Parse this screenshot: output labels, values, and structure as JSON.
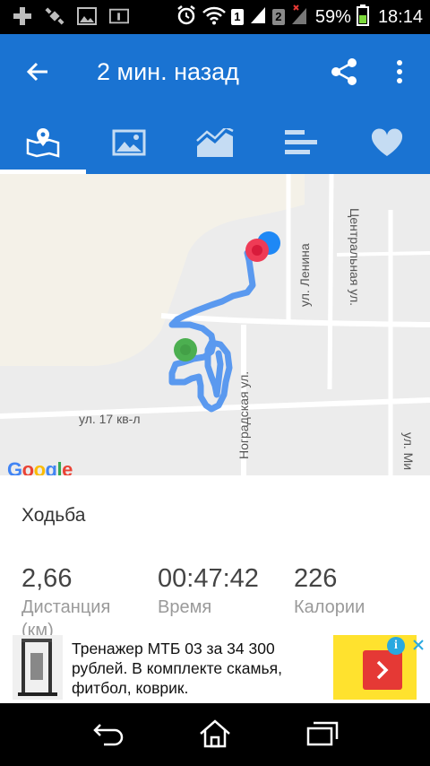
{
  "status_bar": {
    "battery": "59%",
    "time": "18:14",
    "sim1": "1",
    "sim2": "2"
  },
  "appbar": {
    "title": "2 мин. назад",
    "color": "#1a73d2"
  },
  "tabs": [
    {
      "icon": "map-icon",
      "active": true
    },
    {
      "icon": "image-icon",
      "active": false
    },
    {
      "icon": "chart-icon",
      "active": false
    },
    {
      "icon": "bars-icon",
      "active": false
    },
    {
      "icon": "heart-icon",
      "active": false
    }
  ],
  "map": {
    "streets": {
      "lenina": "ул. Ленина",
      "centralnaya": "Центральная ул.",
      "nogradskaya": "Ноградская ул.",
      "kv17": "ул. 17 кв-л",
      "mi": "ул. Ми"
    },
    "attribution": "Google",
    "route_color": "#4a90f0",
    "start_color": "#4caf50",
    "end_color": "#ef3b56",
    "location_color": "#1e88f5"
  },
  "activity": {
    "type": "Ходьба",
    "stats": [
      {
        "value": "2,66",
        "label": "Дистанция"
      },
      {
        "value": "00:47:42",
        "label": "Время"
      },
      {
        "value": "226",
        "label": "Калории"
      }
    ],
    "unit_partial": "(км)"
  },
  "ad": {
    "text": "Тренажер МТБ 03 за 34 300 рублей. В комплекте скамья, фитбол, коврик.",
    "cta_color": "#ffe22e",
    "info_label": "i"
  }
}
